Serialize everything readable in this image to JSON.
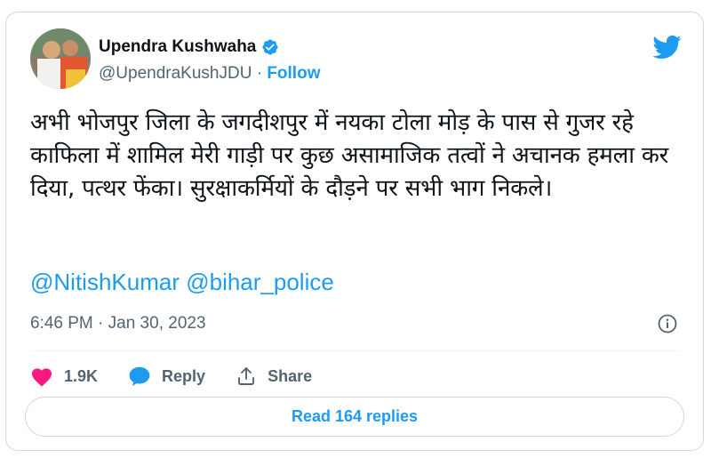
{
  "author": {
    "name": "Upendra Kushwaha",
    "handle": "@UpendraKushJDU",
    "separator": " · ",
    "follow_label": "Follow",
    "verified": true
  },
  "tweet": {
    "text": "अभी भोजपुर जिला के जगदीशपुर में नयका टोला मोड़ के पास से गुजर रहे काफिला में शामिल मेरी गाड़ी पर कुछ असामाजिक तत्वों ने अचानक हमला कर दिया, पत्थर फेंका। सुरक्षाकर्मियों के दौड़ने पर सभी भाग निकले।",
    "mentions": [
      "@NitishKumar",
      "@bihar_police"
    ],
    "timestamp": "6:46 PM · Jan 30, 2023"
  },
  "actions": {
    "like_count": "1.9K",
    "reply_label": "Reply",
    "share_label": "Share"
  },
  "read_replies_label": "Read 164 replies",
  "icons": {
    "logo": "twitter-bird-icon",
    "verified": "verified-badge-icon",
    "info": "info-icon",
    "like": "heart-icon",
    "reply": "speech-bubble-icon",
    "share": "share-arrow-icon"
  },
  "colors": {
    "accent": "#1d9bf0",
    "like": "#f91880",
    "text": "#0f1419",
    "secondary": "#536471",
    "border": "#cfd9de"
  }
}
